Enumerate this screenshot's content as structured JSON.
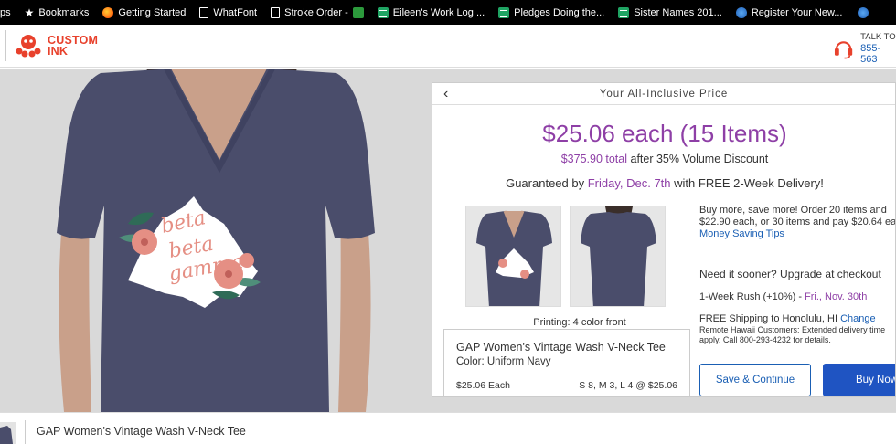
{
  "bookmarks": [
    {
      "label": "ps",
      "icon": "none"
    },
    {
      "label": "Bookmarks",
      "icon": "star-icon"
    },
    {
      "label": "Getting Started",
      "icon": "firefox-icon"
    },
    {
      "label": "WhatFont",
      "icon": "document-icon"
    },
    {
      "label": "Stroke Order -",
      "icon": "document-icon"
    },
    {
      "label": "Eileen's Work Log ...",
      "icon": "spreadsheet-icon"
    },
    {
      "label": "Pledges Doing the...",
      "icon": "spreadsheet-icon"
    },
    {
      "label": "Sister Names 201...",
      "icon": "spreadsheet-icon"
    },
    {
      "label": "Register Your New...",
      "icon": "globe-icon"
    }
  ],
  "header": {
    "logo_line1": "CUSTOM",
    "logo_line2": "INK",
    "talk_label": "TALK TO",
    "phone": "855-563"
  },
  "design": {
    "text_line1": "beta",
    "text_line2": "beta",
    "text_line3": "gamma"
  },
  "panel": {
    "title": "Your All-Inclusive Price",
    "price": "$25.06 each (15 Items)",
    "total_amount": "$375.90 total",
    "total_rest": "after 35% Volume Discount",
    "guarantee_prefix": "Guaranteed by",
    "guarantee_date": "Friday, Dec. 7th",
    "guarantee_suffix": "with FREE 2-Week Delivery!",
    "printing": "Printing: 4 color front",
    "product_name": "GAP Women's Vintage Wash V-Neck Tee",
    "product_color": "Color: Uniform Navy",
    "each_price": "$25.06 Each",
    "sizes": "S 8, M 3, L 4 @ $25.06",
    "buy_more_1": "Buy more, save more! Order 20 items and",
    "buy_more_2": "$22.90 each, or 30 items and pay $20.64 ea",
    "money_tips": "Money Saving Tips",
    "sooner": "Need it sooner? Upgrade at checkout",
    "rush_prefix": "1-Week Rush (+10%) -",
    "rush_date": "Fri., Nov. 30th",
    "ship_prefix": "FREE Shipping to Honolulu, HI",
    "ship_change": "Change",
    "hawaii_note": "Remote Hawaii Customers: Extended delivery time apply. Call 800-293-4232 for details.",
    "save_button": "Save & Continue",
    "buy_button": "Buy Now"
  },
  "footer": {
    "title": "GAP Women's Vintage Wash V-Neck Tee"
  },
  "colors": {
    "brand_red": "#e8412c",
    "accent_purple": "#8e3fa6",
    "link_blue": "#1a5fb4",
    "shirt_navy": "#4a4d6b",
    "design_pink": "#e58f84"
  }
}
